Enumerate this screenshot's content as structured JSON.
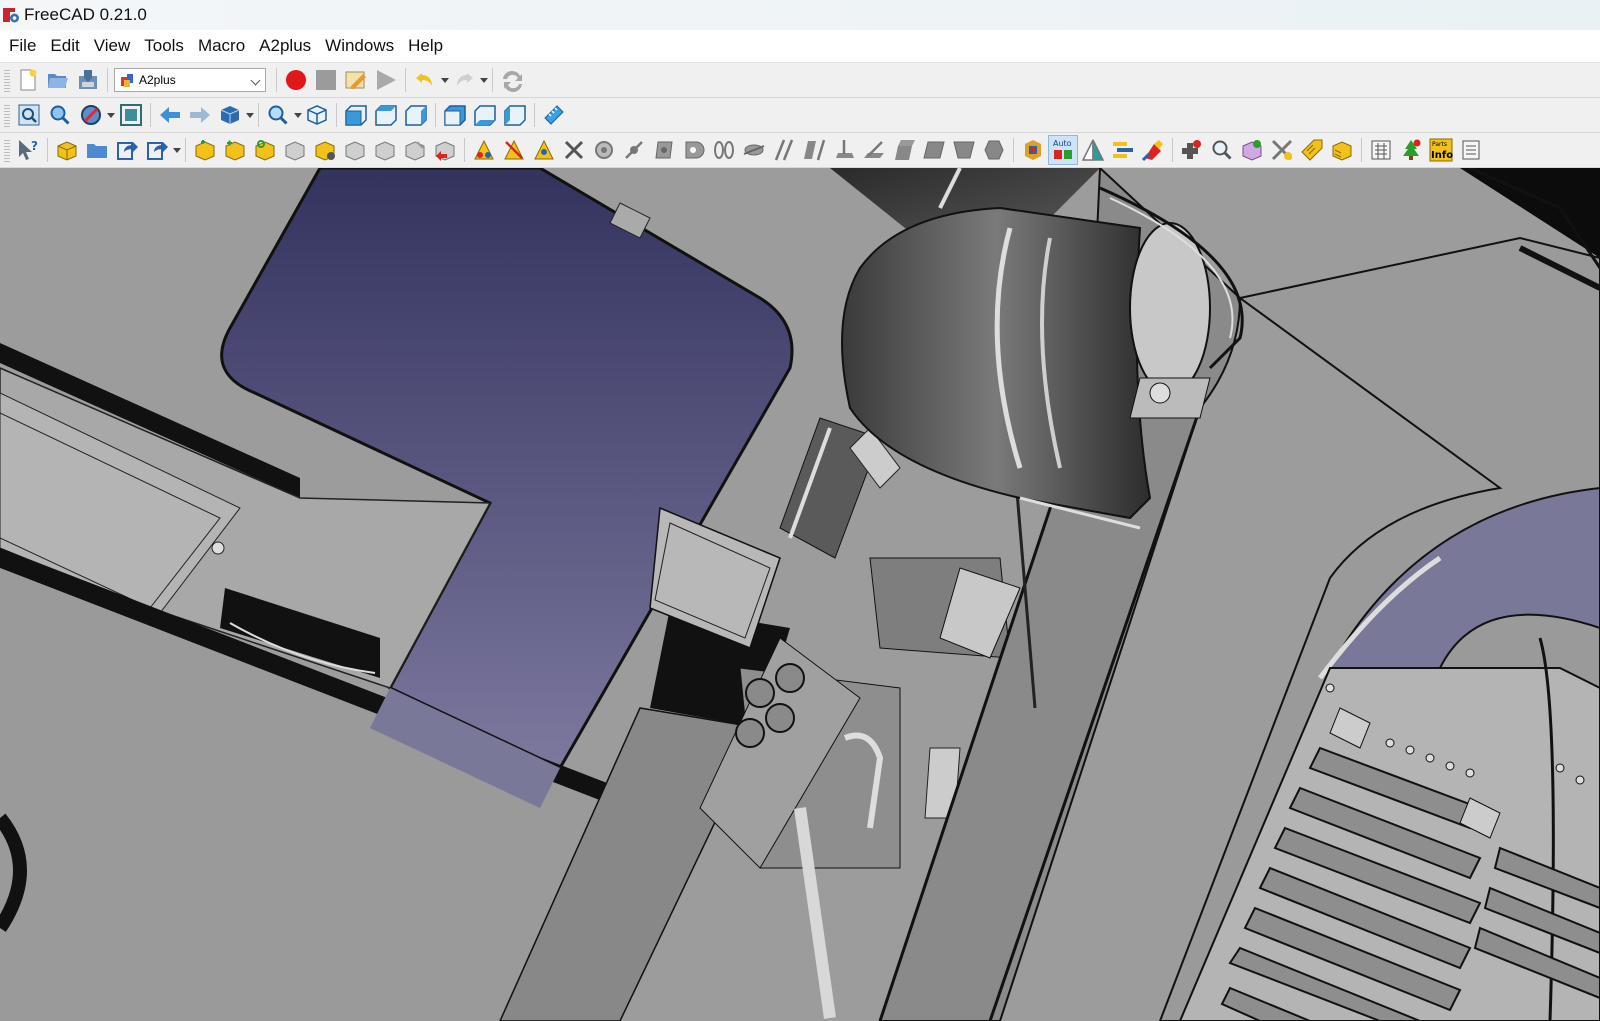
{
  "window": {
    "title": "FreeCAD 0.21.0"
  },
  "menubar": {
    "items": [
      "File",
      "Edit",
      "View",
      "Tools",
      "Macro",
      "A2plus",
      "Windows",
      "Help"
    ]
  },
  "toolbar_file": {
    "workbench_selector": {
      "value": "A2plus"
    },
    "icons": [
      "new-document-icon",
      "open-folder-icon",
      "save-icon",
      "record-macro-icon",
      "stop-macro-icon",
      "edit-macro-icon",
      "run-macro-icon",
      "undo-icon",
      "redo-icon",
      "refresh-icon"
    ]
  },
  "toolbar_view": {
    "icons": [
      "fit-all-icon",
      "fit-selection-icon",
      "draw-style-icon",
      "bounding-box-icon",
      "back-icon",
      "forward-icon",
      "std-views-icon",
      "zoom-icon",
      "isometric-view-icon",
      "front-view-icon",
      "top-view-icon",
      "right-view-icon",
      "rear-view-icon",
      "bottom-view-icon",
      "left-view-icon",
      "measure-icon"
    ]
  },
  "toolbar_a2plus": {
    "auto_label": "Auto",
    "parts_label": "Parts",
    "info_label": "Info"
  },
  "colors": {
    "viewport_gray": "#9a9a9a",
    "sky_top": "#33335f",
    "sky_bottom": "#7c789e",
    "toolbar_bg": "#f0f0f0"
  }
}
